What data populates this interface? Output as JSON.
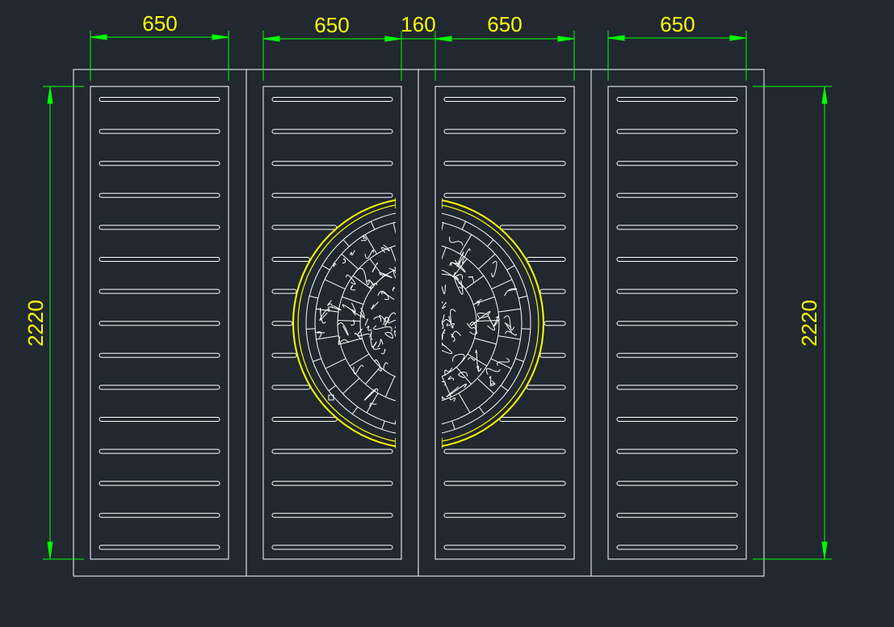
{
  "drawing": {
    "colors": {
      "background": "#212830",
      "outline": "#ffffff",
      "dimension_line": "#00ff00",
      "dimension_text": "#ffff00",
      "medallion_ring": "#ffff00"
    },
    "dimensions": {
      "top": [
        "650",
        "650",
        "160",
        "650",
        "650"
      ],
      "left_height": "2220",
      "right_height": "2220"
    },
    "panel_count": 4,
    "slots_per_panel": 15,
    "medallion": "semicircular carved floral screen split across the two center panels"
  }
}
